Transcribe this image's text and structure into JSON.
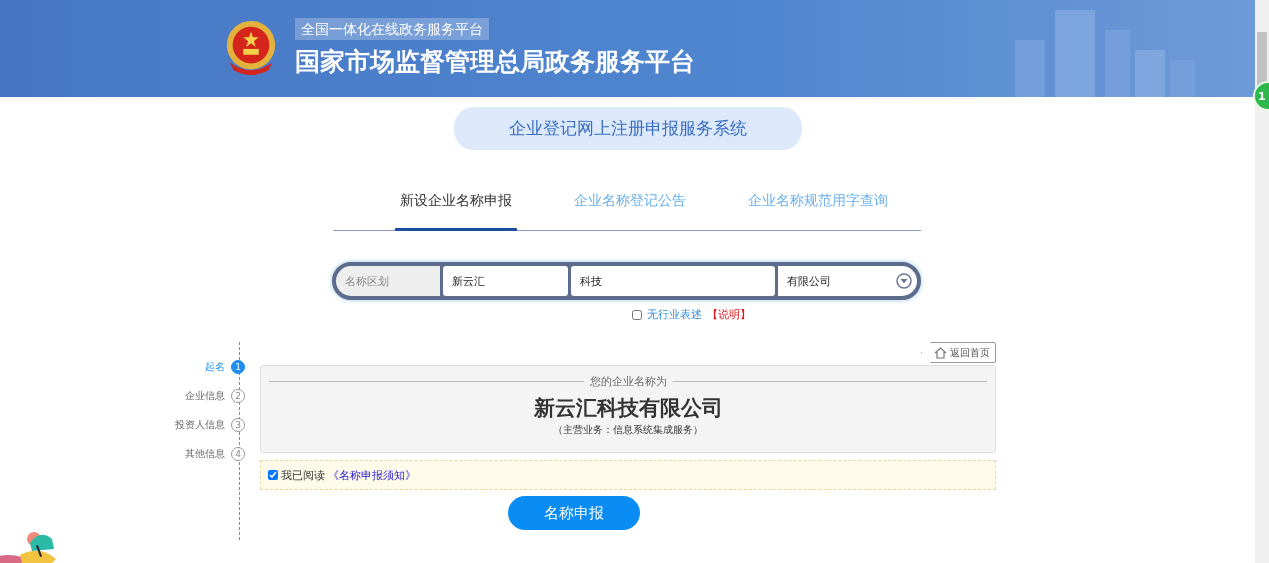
{
  "header": {
    "subtitle": "全国一体化在线政务服务平台",
    "title": "国家市场监督管理总局政务服务平台"
  },
  "system_title": "企业登记网上注册申报服务系统",
  "tabs": [
    {
      "label": "新设企业名称申报",
      "selected": true
    },
    {
      "label": "企业名称登记公告",
      "selected": false
    },
    {
      "label": "企业名称规范用字查询",
      "selected": false
    }
  ],
  "name_fields": [
    {
      "kind": "region",
      "placeholder": "名称区划"
    },
    {
      "kind": "text",
      "value": "新云汇"
    },
    {
      "kind": "text",
      "value": "科技"
    },
    {
      "kind": "select",
      "value": "有限公司"
    }
  ],
  "no_industry": {
    "label": "无行业表述",
    "checked": false,
    "note": "【说明】"
  },
  "steps": [
    {
      "label": "起名",
      "number": "1",
      "selected": true
    },
    {
      "label": "企业信息",
      "number": "2",
      "selected": false
    },
    {
      "label": "投资人信息",
      "number": "3",
      "selected": false
    },
    {
      "label": "其他信息",
      "number": "4",
      "selected": false
    }
  ],
  "back_home": "返回首页",
  "result": {
    "caption": "您的企业名称为",
    "name": "新云汇科技有限公司",
    "business": "（主营业务：信息系统集成服务）"
  },
  "agreement": {
    "checked": true,
    "text": "我已阅读",
    "link": "《名称申报须知》"
  },
  "submit": "名称申报",
  "badge": "1"
}
